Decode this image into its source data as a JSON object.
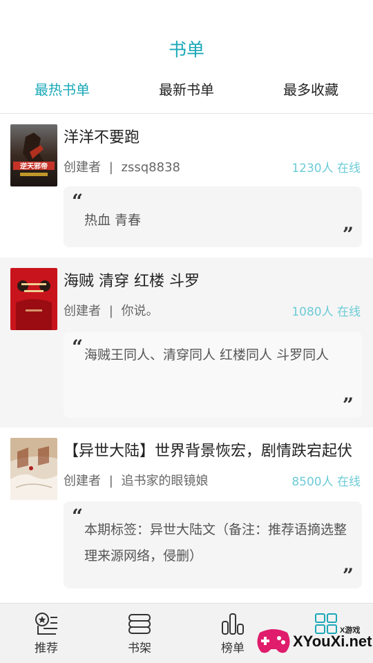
{
  "header": {
    "title": "书单",
    "tabs": [
      {
        "label": "最热书单",
        "active": true
      },
      {
        "label": "最新书单",
        "active": false
      },
      {
        "label": "最多收藏",
        "active": false
      }
    ]
  },
  "booklists": [
    {
      "title": "洋洋不要跑",
      "creator_label": "创建者",
      "separator": "|",
      "creator": "zssq8838",
      "online": "1230人 在线",
      "description": "热血 青春",
      "cover_text": "逆天邪帝"
    },
    {
      "title": "海贼 清穿 红楼  斗罗",
      "creator_label": "创建者",
      "separator": "|",
      "creator": "你说。",
      "online": "1080人 在线",
      "description": "海贼王同人、清穿同人 红楼同人 斗罗同人"
    },
    {
      "title": "【异世大陆】世界背景恢宏，剧情跌宕起伏",
      "creator_label": "创建者",
      "separator": "|",
      "creator": "追书家的眼镜娘",
      "online": "8500人 在线",
      "description": "本期标签：异世大陆文（备注：推荐语摘选整理来源网络，侵删）"
    }
  ],
  "bottom_nav": [
    {
      "label": "推荐",
      "icon": "star-list-icon"
    },
    {
      "label": "书架",
      "icon": "bookshelf-icon"
    },
    {
      "label": "榜单",
      "icon": "ranking-bars-icon"
    },
    {
      "label": "",
      "icon": "grid-icon"
    }
  ],
  "watermark": {
    "small": "X游戏",
    "big": "XYouXi.net"
  },
  "colors": {
    "accent": "#1aa8b8",
    "online": "#6ccbd6",
    "alt_background": "#f5f5f5"
  }
}
